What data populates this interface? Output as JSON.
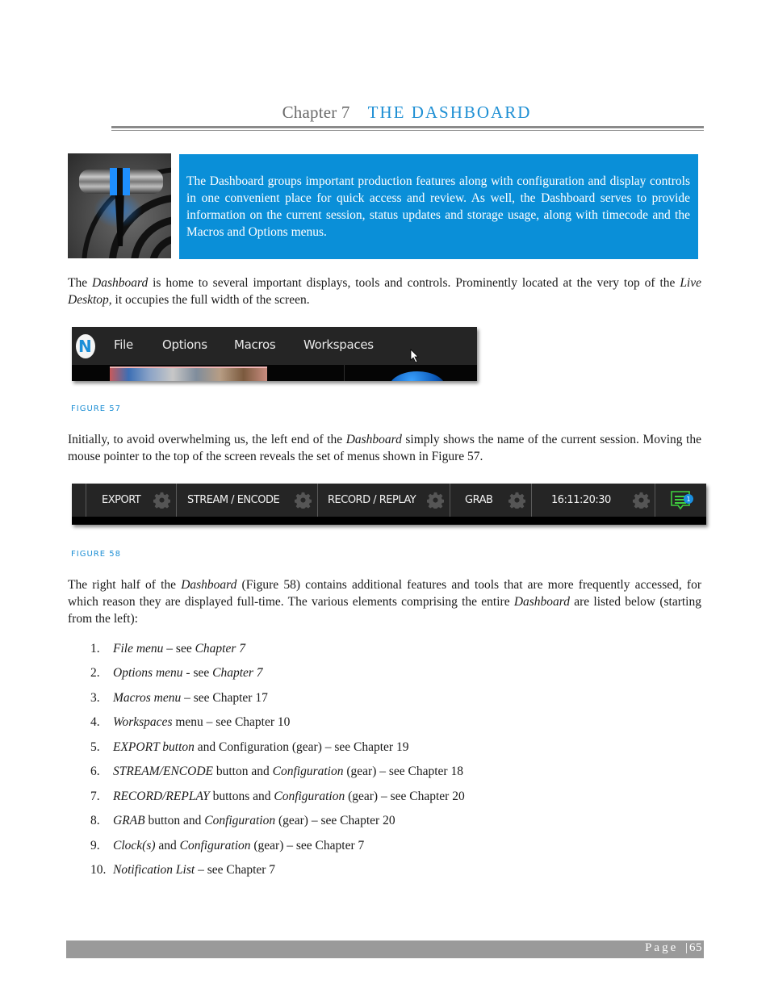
{
  "chapter": {
    "number": "Chapter 7",
    "title": "THE DASHBOARD",
    "accent_color": "#1e8fd4"
  },
  "intro": {
    "icon": "t-bar-fader-icon",
    "text": "The Dashboard groups important production features along with configuration and display controls in one convenient place for quick access and review. As well, the Dashboard serves to provide information on the current session, status updates and storage usage, along with timecode and the Macros and Options menus.",
    "box_color": "#0a8fd8"
  },
  "paragraph1": {
    "t1": "The ",
    "i1": "Dashboard",
    "t2": " is home to several important displays, tools and controls.  Prominently located at the very top of the ",
    "i2": "Live Desktop",
    "t3": ", it occupies the full width of the screen."
  },
  "figure57": {
    "logo": "N",
    "menu": [
      "File",
      "Options",
      "Macros",
      "Workspaces"
    ],
    "caption": "FIGURE 57"
  },
  "paragraph2": {
    "t1": "Initially, to avoid overwhelming us, the left end of the ",
    "i1": "Dashboard",
    "t2": " simply shows the name of the current session.  Moving the mouse pointer to the top of the screen reveals the set of menus shown in  Figure 57."
  },
  "figure58": {
    "buttons": [
      "EXPORT",
      "STREAM / ENCODE",
      "RECORD / REPLAY",
      "GRAB"
    ],
    "clock": "16:11:20:30",
    "notification_count": "1",
    "notification_color": "#3fd13f",
    "badge_color": "#1a8fe0",
    "caption": "FIGURE 58"
  },
  "paragraph3": {
    "t1": "The right half of the ",
    "i1": "Dashboard",
    "t2": " (Figure 58) contains additional features and tools that are more frequently accessed, for which reason they are displayed full-time. The various elements comprising the entire ",
    "i2": "Dashboard",
    "t3": " are listed below (starting from the left):"
  },
  "list": [
    {
      "num": "1.",
      "a": "File menu",
      "b": " – see ",
      "c": "Chapter 7",
      "d": "",
      "e": "",
      "f": ""
    },
    {
      "num": "2.",
      "a": "Options menu",
      "b": " - see ",
      "c": "Chapter 7",
      "d": "",
      "e": "",
      "f": ""
    },
    {
      "num": "3.",
      "a": "Macros menu",
      "b": " – see Chapter 17",
      "c": "",
      "d": "",
      "e": "",
      "f": ""
    },
    {
      "num": "4.",
      "a": "Workspaces",
      "b": " menu – see Chapter 10",
      "c": "",
      "d": "",
      "e": "",
      "f": ""
    },
    {
      "num": "5.",
      "a": "EXPORT button",
      "b": " and Configuration (gear) – see Chapter 19",
      "c": "",
      "d": "",
      "e": "",
      "f": ""
    },
    {
      "num": "6.",
      "a": "STREAM/ENCODE",
      "b": " button and ",
      "c": "Configuration",
      "d": " (gear) – see Chapter 18",
      "e": "",
      "f": ""
    },
    {
      "num": "7.",
      "a": "RECORD/REPLAY",
      "b": " buttons and ",
      "c": "Configuration",
      "d": " (gear) – see Chapter 20",
      "e": "",
      "f": ""
    },
    {
      "num": "8.",
      "a": "GRAB",
      "b": " button and ",
      "c": "Configuration",
      "d": " (gear) – see Chapter 20",
      "e": "",
      "f": ""
    },
    {
      "num": "9.",
      "a": "Clock(s)",
      "b": " and ",
      "c": "Configuration",
      "d": " (gear) – see Chapter 7",
      "e": "",
      "f": ""
    },
    {
      "num": "10.",
      "a": "Notification List",
      "b": " – see Chapter 7",
      "c": "",
      "d": "",
      "e": "",
      "f": ""
    }
  ],
  "footer": {
    "label": "Page",
    "separator": "|",
    "page_number": "65"
  }
}
